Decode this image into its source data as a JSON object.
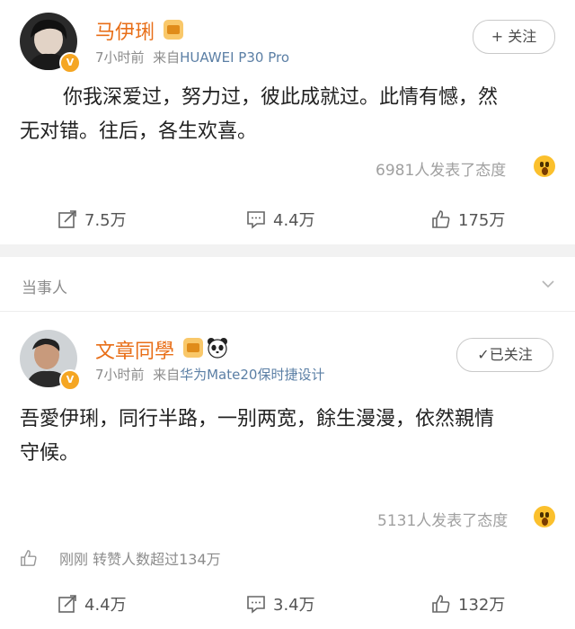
{
  "post1": {
    "username": "马伊琍",
    "time": "7小时前",
    "source_prefix": "来自",
    "source": "HUAWEI P30 Pro",
    "follow_label": "+ 关注",
    "content_line1": "你我深爱过，努力过，彼此成就过。此情有憾，然",
    "content_line2": "无对错。往后，各生欢喜。",
    "reactions": "6981人发表了态度",
    "actions": {
      "repost": "7.5万",
      "comment": "4.4万",
      "like": "175万"
    }
  },
  "section": {
    "title": "当事人"
  },
  "post2": {
    "username": "文章同學",
    "time": "7小时前",
    "source_prefix": "来自",
    "source": "华为Mate20保时捷设计",
    "follow_label": "已关注",
    "content_line1": "吾愛伊琍，同行半路，一别两宽，餘生漫漫，依然親情",
    "content_line2": "守候。",
    "reactions": "5131人发表了态度",
    "liked_text": "刚刚 转赞人数超过134万",
    "actions": {
      "repost": "4.4万",
      "comment": "3.4万",
      "like": "132万"
    }
  },
  "colors": {
    "username": "#e86e17",
    "verified": "#f5a623",
    "source": "#5b7fa5"
  },
  "icons": [
    "verified-v-icon",
    "vip-crown-icon",
    "panda-icon",
    "surprised-emoji-icon",
    "repost-icon",
    "comment-icon",
    "like-icon",
    "chevron-down-icon",
    "check-icon"
  ]
}
